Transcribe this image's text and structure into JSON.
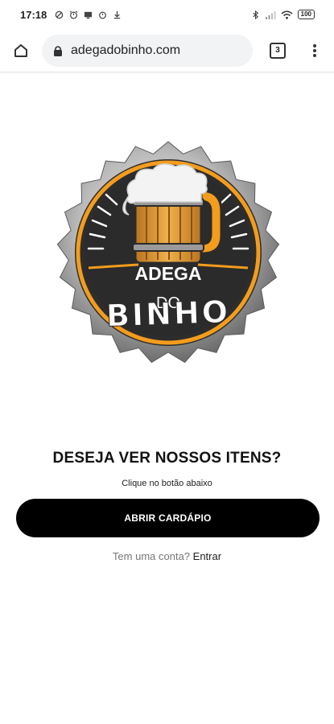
{
  "status_bar": {
    "time": "17:18",
    "battery": "100",
    "icons": [
      "no-disturb-icon",
      "alarm-icon",
      "screen-icon",
      "alarm-icon",
      "download-icon",
      "bluetooth-icon",
      "signal-icon",
      "wifi-icon",
      "battery-icon"
    ]
  },
  "browser": {
    "url": "adegadobinho.com",
    "tab_count": "3"
  },
  "logo": {
    "line1": "ADEGA",
    "line2": "DO",
    "line3": "BINHO",
    "colors": {
      "dark": "#2b2b2b",
      "orange": "#f39c1d",
      "wood": "#e8a23a",
      "metal": "#a9a9a9"
    }
  },
  "main": {
    "headline": "DESEJA VER NOSSOS ITENS?",
    "subtitle": "Clique no botão abaixo",
    "button_label": "ABRIR CARDÁPIO",
    "account_prompt": "Tem uma conta?",
    "login_link": "Entrar"
  }
}
